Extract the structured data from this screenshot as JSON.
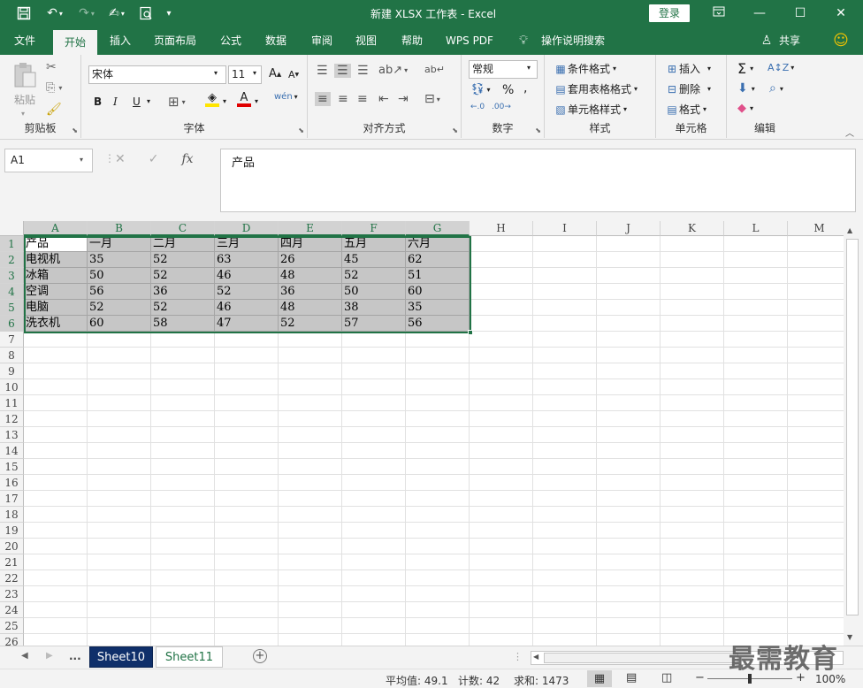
{
  "titlebar": {
    "title": "新建 XLSX 工作表  -  Excel",
    "login": "登录",
    "icons": [
      "save-icon",
      "undo-icon",
      "redo-icon",
      "touch-mode-icon",
      "print-preview-icon",
      "customize-qat-icon"
    ]
  },
  "tabs": [
    "文件",
    "开始",
    "插入",
    "页面布局",
    "公式",
    "数据",
    "审阅",
    "视图",
    "帮助",
    "WPS PDF",
    "操作说明搜索",
    "共享"
  ],
  "ribbon": {
    "clipboard": {
      "label": "剪贴板",
      "paste": "粘贴"
    },
    "font": {
      "label": "字体",
      "name": "宋体",
      "size": "11",
      "bold": "B",
      "italic": "I",
      "underline": "U"
    },
    "alignment": {
      "label": "对齐方式"
    },
    "number": {
      "label": "数字",
      "format": "常规"
    },
    "styles": {
      "label": "样式",
      "conditional": "条件格式",
      "table": "套用表格格式",
      "cell": "单元格样式"
    },
    "cells": {
      "label": "单元格",
      "insert": "插入",
      "delete": "删除",
      "format": "格式"
    },
    "editing": {
      "label": "编辑"
    }
  },
  "formula_bar": {
    "name_box": "A1",
    "content": "产品"
  },
  "columns": [
    "A",
    "B",
    "C",
    "D",
    "E",
    "F",
    "G",
    "H",
    "I",
    "J",
    "K",
    "L",
    "M"
  ],
  "rows": [
    "1",
    "2",
    "3",
    "4",
    "5",
    "6",
    "7",
    "8",
    "9",
    "10",
    "11",
    "12",
    "13",
    "14",
    "15",
    "16",
    "17",
    "18",
    "19",
    "20",
    "21",
    "22",
    "23",
    "24",
    "25",
    "26"
  ],
  "cells": [
    [
      "产品",
      "一月",
      "二月",
      "三月",
      "四月",
      "五月",
      "六月"
    ],
    [
      "电视机",
      "35",
      "52",
      "63",
      "26",
      "45",
      "62"
    ],
    [
      "冰箱",
      "50",
      "52",
      "46",
      "48",
      "52",
      "51"
    ],
    [
      "空调",
      "56",
      "36",
      "52",
      "36",
      "50",
      "60"
    ],
    [
      "电脑",
      "52",
      "52",
      "46",
      "48",
      "38",
      "35"
    ],
    [
      "洗衣机",
      "60",
      "58",
      "47",
      "52",
      "57",
      "56"
    ]
  ],
  "sheets": {
    "ellipsis": "...",
    "list": [
      "Sheet10",
      "Sheet11"
    ],
    "active": "Sheet10"
  },
  "status": {
    "average": "平均值: 49.1",
    "count": "计数: 42",
    "sum": "求和: 1473",
    "zoom": "100%"
  },
  "watermark": "最需教育"
}
